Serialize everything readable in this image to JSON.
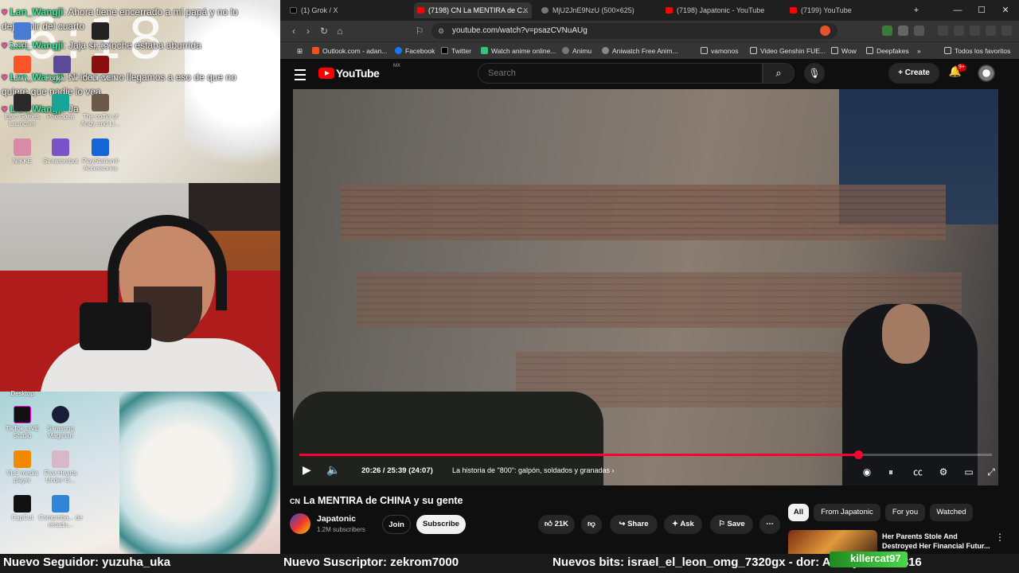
{
  "overlay": {
    "clock": "6:18",
    "chat": [
      {
        "user": "Lan_Wangji",
        "text": "Ahora tiene encerrado a mi papá y no lo deja salir del cuarto"
      },
      {
        "user": "Lan_Wangji",
        "text": "Jaja si, anoche estaba aburrida"
      },
      {
        "user": "Lan_Wangji",
        "text": "Ni idea como llegamos a eso de que no quiere que nadie lo vea"
      },
      {
        "user": "Lan_Wangji",
        "text": "Ja"
      }
    ],
    "desktop_icons_top": [
      "Recicla...",
      "Honkai Star",
      "Legacy",
      "Brave",
      "CODE VEIN",
      "Epic Games Launcher",
      "Photopea",
      "The coffin of Andy and Li...",
      "NIKKE",
      "Streamerbot",
      "PlayStation® Accessories"
    ],
    "desktop_icons_bottom": [
      "Desktop",
      "TikTok LIVE Studio",
      "Samsung Magician",
      "VLC media player",
      "Five Hearts Under O...",
      "CapCut",
      "Comproba... de estado..."
    ]
  },
  "tabs": [
    {
      "label": "(1) Grok / X",
      "color": "#000000"
    },
    {
      "label": "(7198) CN La MENTIRA de C...",
      "color": "#ff0000"
    },
    {
      "label": "MjU2JnE9NzU (500×625)",
      "color": "#888888"
    },
    {
      "label": "(7198) Japatonic - YouTube",
      "color": "#ff0000"
    },
    {
      "label": "(7199) YouTube",
      "color": "#ff0000"
    }
  ],
  "url": "youtube.com/watch?v=psazCVNuAUg",
  "bookmarks": [
    "Outlook.com - adan...",
    "Facebook",
    "Twitter",
    "Watch anime online...",
    "Animu",
    "Aniwatch Free Anim...",
    "vamonos",
    "Video Genshin FUE...",
    "Wow",
    "Deepfakes",
    "Todos los favoritos"
  ],
  "youtube": {
    "logo": "YouTube",
    "region": "MX",
    "search_placeholder": "Search",
    "create": "+ Create",
    "notifications": "9+",
    "video": {
      "time": "20:26 / 25:39 (24:07)",
      "chapter": "La historia de \"800\": galpón, soldados y granadas",
      "progress": 0.807
    },
    "title_flag": "CN",
    "title": "La MENTIRA de CHINA y su gente",
    "channel": "Japatonic",
    "subscribers": "1.2M subscribers",
    "join": "Join",
    "subscribe": "Subscribe",
    "likes": "21K",
    "share": "Share",
    "ask": "Ask",
    "save": "Save",
    "chips": [
      "All",
      "From Japatonic",
      "For you",
      "Watched"
    ],
    "rec_title": "Her Parents Stole And Destroyed Her Financial Futur..."
  },
  "ticker": {
    "follower": "Nuevo Seguidor: yuzuha_uka",
    "subscriber": "Nuevo Suscriptor: zekrom7000",
    "bits": "Nuevos bits: israel_el_leon_omg_7320gx - dor: Anonymous - $16",
    "highlight": "killercat97"
  }
}
